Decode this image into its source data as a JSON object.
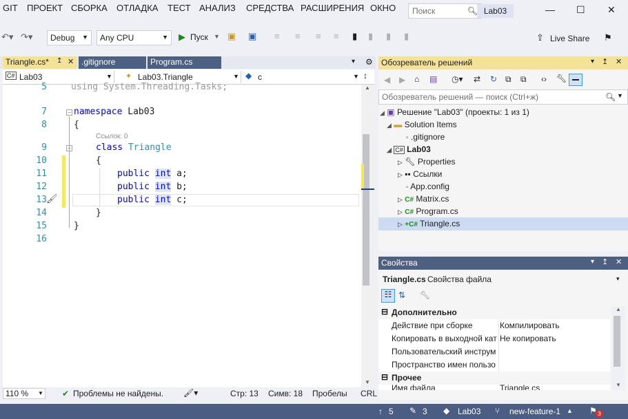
{
  "menu": [
    "GIT",
    "ПРОЕКТ",
    "СБОРКА",
    "ОТЛАДКА",
    "ТЕСТ",
    "АНАЛИЗ",
    "СРЕДСТВА",
    "РАСШИРЕНИЯ",
    "ОКНО"
  ],
  "search_placeholder": "Поиск",
  "solution_badge": "Lab03",
  "toolbar": {
    "config": "Debug",
    "platform": "Any CPU",
    "start": "Пуск",
    "live_share": "Live Share"
  },
  "tabs": [
    {
      "label": "Triangle.cs*",
      "active": true
    },
    {
      "label": ".gitignore",
      "active": false
    },
    {
      "label": "Program.cs",
      "active": false
    }
  ],
  "navbar": {
    "project": "Lab03",
    "type": "Lab03.Triangle",
    "member": "c"
  },
  "code": {
    "line5": "using System.Threading.Tasks;",
    "refs": "Ссылок: 0",
    "ns_kw": "namespace",
    "ns_name": " Lab03",
    "open_brace": "{",
    "close_brace": "}",
    "class_kw": "class",
    "class_name": " Triangle",
    "pub": "public",
    "int": "int",
    "a": " a;",
    "b": " b;",
    "c": " c;",
    "line_numbers": [
      "5",
      "7",
      "8",
      "9",
      "10",
      "11",
      "12",
      "13",
      "14",
      "15",
      "16"
    ]
  },
  "editor_status": {
    "zoom": "110 %",
    "issues": "Проблемы не найдены.",
    "line": "Стр: 13",
    "col": "Симв: 18",
    "spaces": "Пробелы",
    "eol": "CRL"
  },
  "solution_explorer": {
    "title": "Обозреватель решений",
    "search_placeholder": "Обозреватель решений — поиск (Ctrl+ж)",
    "items": [
      {
        "label": "Решение \"Lab03\" (проекты: 1 из 1)",
        "bold": false
      },
      {
        "label": "Solution Items",
        "bold": false
      },
      {
        "label": ".gitignore",
        "bold": false
      },
      {
        "label": "Lab03",
        "bold": true
      },
      {
        "label": "Properties",
        "bold": false
      },
      {
        "label": "Ссылки",
        "bold": false
      },
      {
        "label": "App.config",
        "bold": false
      },
      {
        "label": "Matrix.cs",
        "bold": false
      },
      {
        "label": "Program.cs",
        "bold": false
      },
      {
        "label": "Triangle.cs",
        "bold": false
      }
    ]
  },
  "properties": {
    "title": "Свойства",
    "object_name": "Triangle.cs",
    "object_type": "Свойства файла",
    "cat1": "Дополнительно",
    "rows1": [
      {
        "name": "Действие при сборке",
        "value": "Компилировать"
      },
      {
        "name": "Копировать в выходной кат",
        "value": "Не копировать"
      },
      {
        "name": "Пользовательский инструм",
        "value": ""
      },
      {
        "name": "Пространство имен пользо",
        "value": ""
      }
    ],
    "cat2": "Прочее",
    "rows2": [
      {
        "name": "Имя файла",
        "value": "Triangle.cs"
      }
    ]
  },
  "statusbar": {
    "up": "5",
    "pencil": "3",
    "repo": "Lab03",
    "branch": "new-feature-1",
    "notif": "3"
  },
  "colors": {
    "accent": "#4b5d83",
    "active_panel": "#f4e299",
    "keyword": "#0000ff",
    "type": "#2b91af"
  }
}
